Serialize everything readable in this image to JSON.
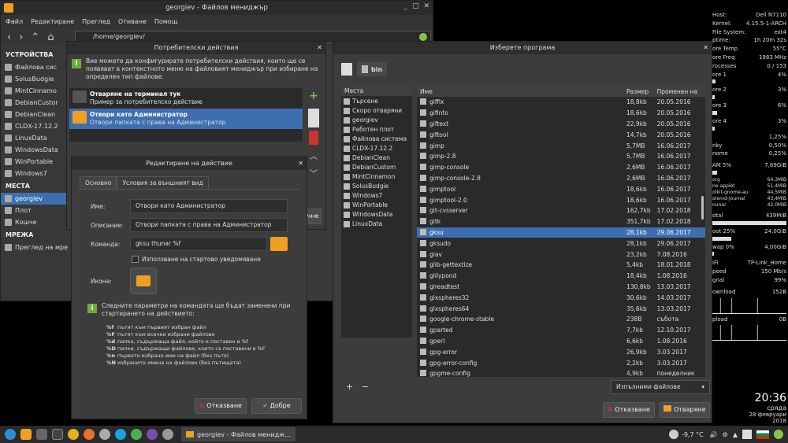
{
  "fm": {
    "title": "georgiev - Файлов мениджър",
    "menu": [
      "Файл",
      "Редактиране",
      "Преглед",
      "Отиване",
      "Помощ"
    ],
    "path": "/home/georgiev/",
    "sidebar": {
      "h_devices": "УСТРОЙСТВА",
      "devices": [
        "Файлова сис",
        "SolusBudgie",
        "MintCinnamo",
        "DebianCustor",
        "DebianClean",
        "CLDX-17.12.2",
        "LinuxData",
        "WindowsData",
        "WinPortable",
        "Windows7"
      ],
      "h_places": "МЕСТА",
      "places": [
        "georgiev",
        "Плот",
        "Кошче"
      ],
      "h_network": "МРЕЖА",
      "network": [
        "Преглед на мре"
      ]
    }
  },
  "ua": {
    "title": "Потребителски действия",
    "info": "Вие можете да конфигурирате потребителски действия, които ще се появяват в контекстното меню на файловият мениджър при избиране на определен тип файлове.",
    "actions": [
      {
        "name": "Отваряне на терминал тук",
        "desc": "Пример за потребителско действие"
      },
      {
        "name": "Отвори като Администратор",
        "desc": "Отвори папката с права на Администратор"
      }
    ],
    "close_partial": "чне"
  },
  "edit": {
    "title": "Редактиране на действие",
    "tab_basic": "Основно",
    "tab_cond": "Условия за външният вид",
    "name_label": "Име:",
    "name_value": "Отвори като Администратор",
    "desc_label": "Описание:",
    "desc_value": "Отвори папката с права на Администратор",
    "cmd_label": "Команда:",
    "cmd_value": "gksu thunar %f",
    "startup": "Използване на стартово уведомяване",
    "icon_label": "Икона:",
    "params_info": "Следните параметри на командата ще бъдат заменени при стартирането на действието:",
    "params": [
      {
        "k": "%f",
        "v": "пътят към първият избран файл"
      },
      {
        "k": "%F",
        "v": "пътят към всички избрани файлове"
      },
      {
        "k": "%d",
        "v": "папка, съдържаща файл, който е поставен в %f"
      },
      {
        "k": "%D",
        "v": "папки, съдържащи файлове, които са поставени в %F"
      },
      {
        "k": "%n",
        "v": "първото избрано име на файл (без пътя)"
      },
      {
        "k": "%N",
        "v": "избраните имена на файлове (без пътищата)"
      }
    ],
    "cancel": "Отказване",
    "ok": "Добре"
  },
  "chooser": {
    "title": "Изберете програма",
    "crumb": "bin",
    "places_h": "Места",
    "places": [
      "Търсене",
      "Скоро отваряни",
      "georgiev",
      "Работен плот",
      "Файлова система",
      "CLDX-17.12.2",
      "DebianClean",
      "DebianCustom",
      "MintCinnamon",
      "SolusBudgie",
      "Windows7",
      "WinPortable",
      "WindowsData",
      "LinuxData"
    ],
    "col_name": "Име",
    "col_size": "Размер",
    "col_mod": "Променен на",
    "rows": [
      [
        "giffix",
        "18,8kb",
        "20.05.2016"
      ],
      [
        "gifinto",
        "18,6kb",
        "20.05.2016"
      ],
      [
        "giftext",
        "22,9kb",
        "20.05.2016"
      ],
      [
        "giftool",
        "14,7kb",
        "20.05.2016"
      ],
      [
        "gimp",
        "5,7MB",
        "16.06.2017"
      ],
      [
        "gimp-2.8",
        "5,7MB",
        "16.06.2017"
      ],
      [
        "gimp-console",
        "2,6MB",
        "16.06.2017"
      ],
      [
        "gimp-console-2.8",
        "2,6MB",
        "16.06.2017"
      ],
      [
        "gimptool",
        "18,6kb",
        "16.06.2017"
      ],
      [
        "gimptool-2.0",
        "18,6kb",
        "16.06.2017"
      ],
      [
        "git-cvsserver",
        "162,7kb",
        "17.02.2018"
      ],
      [
        "gitk",
        "351,7kb",
        "17.02.2018"
      ],
      [
        "gksu",
        "28,1kb",
        "29.06.2017"
      ],
      [
        "gksudo",
        "28,1kb",
        "29.06.2017"
      ],
      [
        "glav",
        "23,2kb",
        "7.08.2016"
      ],
      [
        "glib-gettextize",
        "5,4kb",
        "18.01.2018"
      ],
      [
        "glilypond",
        "18,4kb",
        "1.08.2016"
      ],
      [
        "glreadtest",
        "130,8kb",
        "13.03.2017"
      ],
      [
        "glxspheres32",
        "30,6kb",
        "14.03.2017"
      ],
      [
        "glxspheres64",
        "35,6kb",
        "13.03.2017"
      ],
      [
        "google-chrome-stable",
        "238B",
        "събота"
      ],
      [
        "gparted",
        "7,7kb",
        "12.10.2017"
      ],
      [
        "gperl",
        "6,6kb",
        "1.08.2016"
      ],
      [
        "gpg-error",
        "26,9kb",
        "3.03.2017"
      ],
      [
        "gpg-error-config",
        "2,2kb",
        "3.03.2017"
      ],
      [
        "gpgme-config",
        "4,9kb",
        "понеделник"
      ]
    ],
    "selected_index": 12,
    "filter": "Изпълними файлове",
    "cancel": "Отказване",
    "open": "Отваряне"
  },
  "conky": {
    "lines": [
      [
        "Host:",
        "Dell N7110"
      ],
      [
        "Kernel:",
        "4.15.5-1-ARCH"
      ],
      [
        "File System:",
        "ext4"
      ],
      [
        "ptime:",
        "1h 20m 32s"
      ],
      [
        "",
        ""
      ],
      [
        "ore Temp",
        "55°C"
      ],
      [
        "ore Freq",
        "1983 MHz"
      ],
      [
        "rocesses",
        "0 / 153"
      ]
    ],
    "cores": [
      [
        "ore 1",
        "4%"
      ],
      [
        "ore 2",
        "3%"
      ],
      [
        "ore 3",
        "6%"
      ],
      [
        "ore 4",
        "3%"
      ]
    ],
    "procs": [
      [
        "",
        "1,25%"
      ],
      [
        "nky",
        "0,50%"
      ],
      [
        "nome",
        "0,25%"
      ]
    ],
    "ram": [
      "AM 5%",
      "7,69GiB"
    ],
    "mem": [
      [
        "org",
        "64,3MiB"
      ],
      [
        "ne-applet",
        "51,4MiB"
      ],
      [
        "olkit-gnome-au",
        "44,5MiB"
      ],
      [
        "stemd-journal",
        "43,4MiB"
      ],
      [
        "nunar",
        "42,0MiB"
      ]
    ],
    "total": [
      "otal",
      "439MiB"
    ],
    "root": [
      "oot 25%",
      "24,0GiB"
    ],
    "swap": [
      "wap 0%",
      "4,00GiB"
    ],
    "net": [
      [
        "iFi",
        "TP-Link_Home"
      ],
      [
        "peed",
        "150 Mb/s"
      ],
      [
        "gnal",
        "99%"
      ]
    ],
    "down": [
      "ownload",
      "152B"
    ],
    "up": [
      "pload",
      "0B"
    ],
    "time": "20:36",
    "day": "сряда",
    "date": "28 февруари 2018"
  },
  "taskbar": {
    "task": "georgiev - Файлов менидж...",
    "temp": "-9,7 °C"
  }
}
